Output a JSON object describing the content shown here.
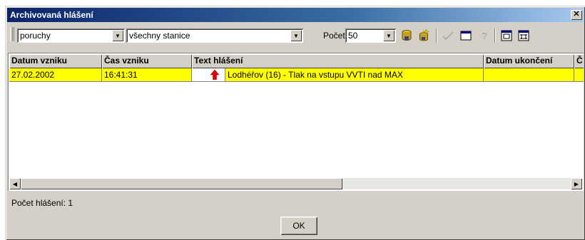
{
  "window": {
    "title": "Archivovaná hlášení",
    "close_glyph": "✕"
  },
  "toolbar": {
    "filter_type": "poruchy",
    "station": "všechny stanice",
    "count_label": "Počet",
    "count_value": "50",
    "dropdown_glyph": "▼",
    "icons": [
      "database-icon",
      "database-star-icon",
      "checkmark-icon",
      "window-icon",
      "help-icon",
      "fit-window-icon",
      "maximize-window-icon"
    ],
    "help_glyph": "?"
  },
  "table": {
    "columns": [
      "Datum vzniku",
      "Čas vzniku",
      "Text hlášení",
      "Datum ukončení",
      "Č"
    ],
    "rows": [
      {
        "date": "27.02.2002",
        "time": "16:41:31",
        "text": "Lodhéřov (16) - Tlak na vstupu VVTI nad MAX",
        "end_date": "",
        "extra": ""
      }
    ],
    "row_color": "#ffff00",
    "alarm_icon_color": "#e00000"
  },
  "status": {
    "count_text": "Počet hlášení: 1"
  },
  "footer": {
    "ok_label": "OK"
  }
}
